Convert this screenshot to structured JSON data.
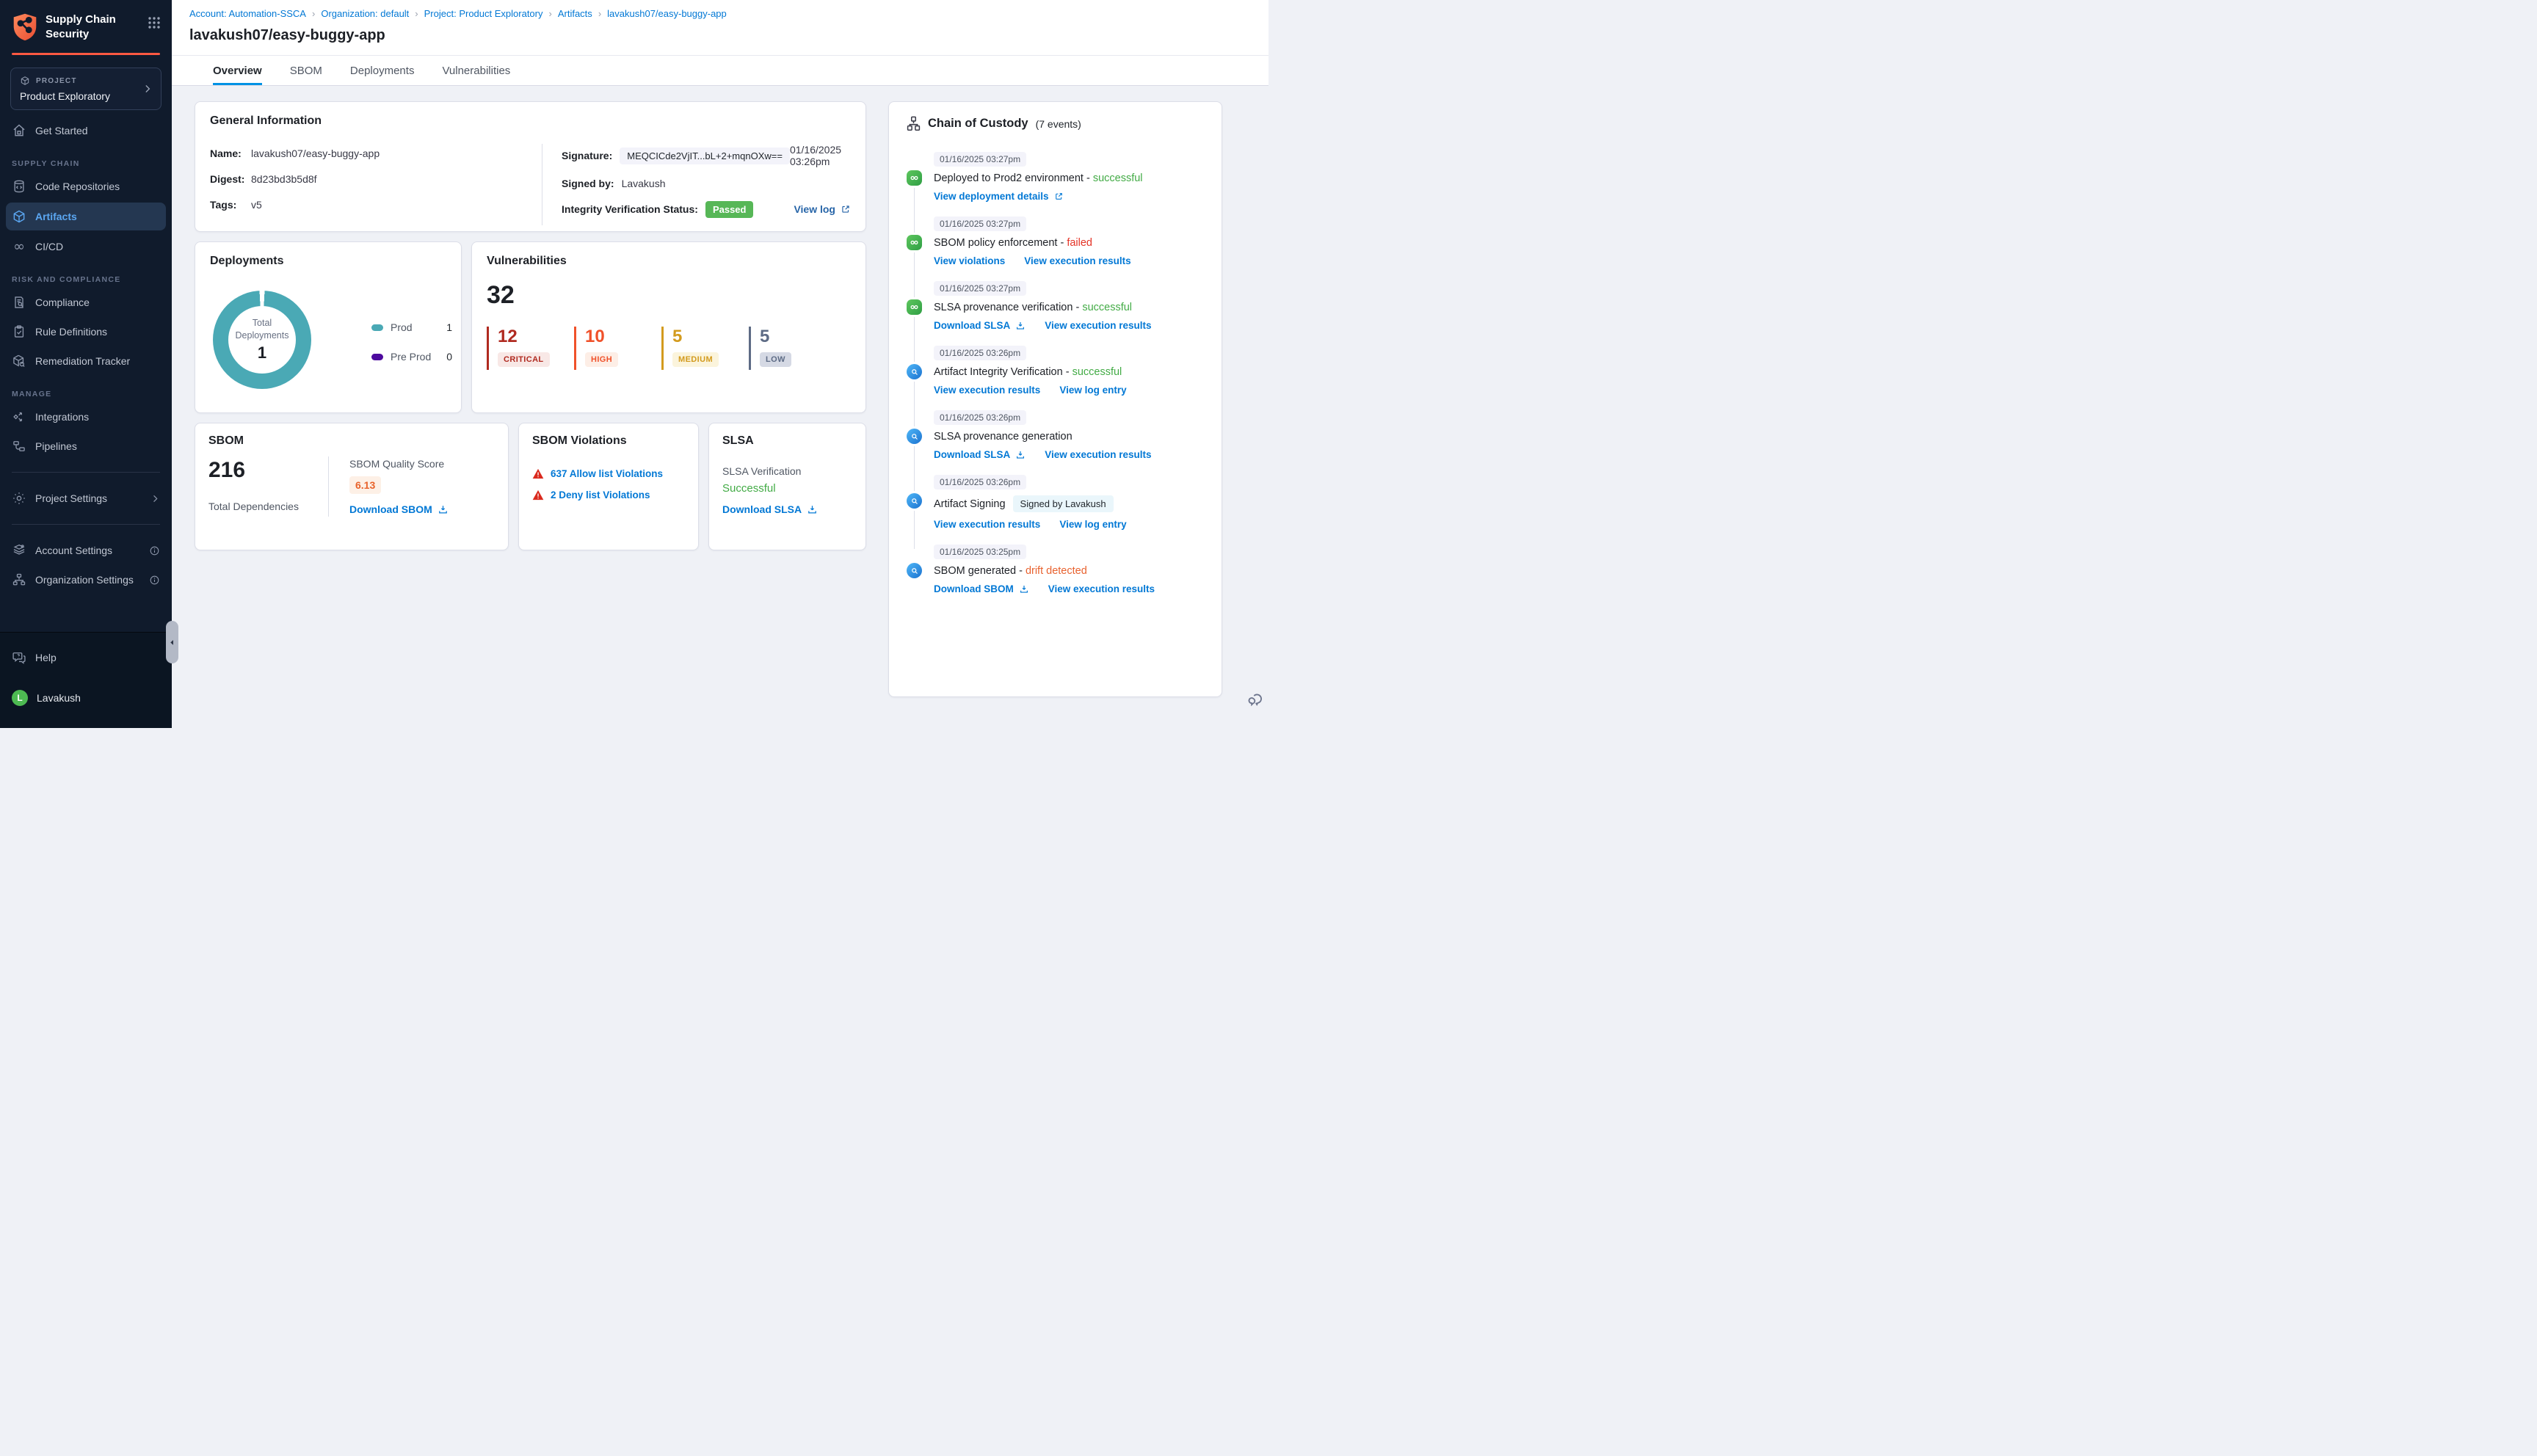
{
  "colors": {
    "accent_orange": "#ff5942",
    "link_blue": "#0278d5",
    "view_log_blue": "#2765a8",
    "passed_green": "#57b757",
    "success_green": "#42ab45",
    "failed_red": "#e43326",
    "drift_orange": "#e8622f",
    "donut_teal": "#4aa9b5",
    "preprod_purple": "#4d0a9e"
  },
  "icons": {
    "module_grid": "grid-9-dots-icon",
    "project_cube": "cube-icon",
    "collapse": "chevron-left-icon",
    "feedback": "chat-bubbles-icon",
    "download": "download-tray-icon",
    "external": "external-link-icon",
    "warning": "warning-triangle-icon",
    "chain_header": "hierarchy-icon"
  },
  "sidebar": {
    "app_title": "Supply Chain Security",
    "project": {
      "label": "PROJECT",
      "name": "Product Exploratory"
    },
    "nav_groups": [
      {
        "header": "",
        "items": [
          {
            "label": "Get Started",
            "icon": "home-icon"
          }
        ]
      },
      {
        "header": "SUPPLY CHAIN",
        "items": [
          {
            "label": "Code Repositories",
            "icon": "repository-icon"
          },
          {
            "label": "Artifacts",
            "icon": "cube-icon",
            "active": true
          },
          {
            "label": "CI/CD",
            "icon": "infinity-icon"
          }
        ]
      },
      {
        "header": "RISK AND COMPLIANCE",
        "items": [
          {
            "label": "Compliance",
            "icon": "document-search-icon"
          },
          {
            "label": "Rule Definitions",
            "icon": "clipboard-check-icon"
          },
          {
            "label": "Remediation Tracker",
            "icon": "box-wrench-icon"
          }
        ]
      },
      {
        "header": "MANAGE",
        "items": [
          {
            "label": "Integrations",
            "icon": "integrations-icon"
          },
          {
            "label": "Pipelines",
            "icon": "pipelines-icon"
          }
        ]
      }
    ],
    "settings": [
      {
        "label": "Project Settings",
        "icon": "gear-icon"
      },
      {
        "label": "Account Settings",
        "icon": "layers-gear-icon"
      },
      {
        "label": "Organization Settings",
        "icon": "org-gear-icon"
      }
    ],
    "footer": {
      "help": "Help",
      "user": "Lavakush",
      "avatar_initial": "L"
    }
  },
  "header": {
    "breadcrumb": [
      "Account: Automation-SSCA",
      "Organization: default",
      "Project: Product Exploratory",
      "Artifacts",
      "lavakush07/easy-buggy-app"
    ],
    "breadcrumb_separator": "›",
    "title": "lavakush07/easy-buggy-app",
    "active_tab": "Overview",
    "tabs": [
      {
        "label": "Overview"
      },
      {
        "label": "SBOM"
      },
      {
        "label": "Deployments"
      },
      {
        "label": "Vulnerabilities"
      }
    ]
  },
  "general_info": {
    "title": "General Information",
    "name_label": "Name:",
    "name": "lavakush07/easy-buggy-app",
    "digest_label": "Digest:",
    "digest": "8d23bd3b5d8f",
    "tags_label": "Tags:",
    "tags": "v5",
    "signature_label": "Signature:",
    "signature": "MEQCICde2VjIT...bL+2+mqnOXw==",
    "signature_date": "01/16/2025 03:26pm",
    "signed_by_label": "Signed by:",
    "signed_by": "Lavakush",
    "integrity_label": "Integrity Verification Status:",
    "integrity_status": "Passed",
    "view_log_label": "View log"
  },
  "deployments": {
    "title": "Deployments",
    "center_label": "Total Deployments",
    "total": "1",
    "legend": [
      {
        "label": "Prod",
        "value": "1",
        "color": "#4aa9b5"
      },
      {
        "label": "Pre Prod",
        "value": "0",
        "color": "#4d0a9e"
      }
    ]
  },
  "vulnerabilities": {
    "title": "Vulnerabilities",
    "total": "32",
    "severities": [
      {
        "count": "12",
        "label": "CRITICAL",
        "color": "#b02a20",
        "badge_bg": "#f8e8e6"
      },
      {
        "count": "10",
        "label": "HIGH",
        "color": "#f0512a",
        "badge_bg": "#fdeee6"
      },
      {
        "count": "5",
        "label": "MEDIUM",
        "color": "#d39b1e",
        "badge_bg": "#fbf4dc"
      },
      {
        "count": "5",
        "label": "LOW",
        "color": "#5d6b85",
        "badge_bg": "#d5d9e4"
      }
    ]
  },
  "sbom": {
    "title": "SBOM",
    "total": "216",
    "total_label": "Total Dependencies",
    "quality_label": "SBOM Quality Score",
    "quality_score": "6.13",
    "download_label": "Download SBOM"
  },
  "sbom_violations": {
    "title": "SBOM Violations",
    "items": [
      {
        "text": "637 Allow list Violations"
      },
      {
        "text": "2 Deny list Violations"
      }
    ]
  },
  "slsa": {
    "title": "SLSA",
    "verification_label": "SLSA Verification",
    "status": "Successful",
    "download_label": "Download SLSA"
  },
  "chain": {
    "title": "Chain of Custody",
    "events_label": "(7 events)",
    "separator": " - ",
    "events": [
      {
        "timestamp": "01/16/2025 03:27pm",
        "title": "Deployed to Prod2 environment",
        "status": "successful",
        "links": [
          {
            "text": "View deployment details"
          }
        ]
      },
      {
        "timestamp": "01/16/2025 03:27pm",
        "title": "SBOM policy enforcement",
        "status": "failed",
        "links": [
          {
            "text": "View violations"
          },
          {
            "text": "View execution results"
          }
        ]
      },
      {
        "timestamp": "01/16/2025 03:27pm",
        "title": "SLSA provenance verification",
        "status": "successful",
        "links": [
          {
            "text": "Download SLSA"
          },
          {
            "text": "View execution results"
          }
        ]
      },
      {
        "timestamp": "01/16/2025 03:26pm",
        "title": "Artifact Integrity Verification",
        "status": "successful",
        "links": [
          {
            "text": "View execution results"
          },
          {
            "text": "View log entry"
          }
        ]
      },
      {
        "timestamp": "01/16/2025 03:26pm",
        "title": "SLSA provenance generation",
        "status": "",
        "links": [
          {
            "text": "Download SLSA"
          },
          {
            "text": "View execution results"
          }
        ]
      },
      {
        "timestamp": "01/16/2025 03:26pm",
        "title": "Artifact Signing",
        "status": "",
        "badge": "Signed by Lavakush",
        "links": [
          {
            "text": "View execution results"
          },
          {
            "text": "View log entry"
          }
        ]
      },
      {
        "timestamp": "01/16/2025 03:25pm",
        "title": "SBOM generated",
        "status": "drift detected",
        "links": [
          {
            "text": "Download SBOM"
          },
          {
            "text": "View execution results"
          }
        ]
      }
    ]
  }
}
